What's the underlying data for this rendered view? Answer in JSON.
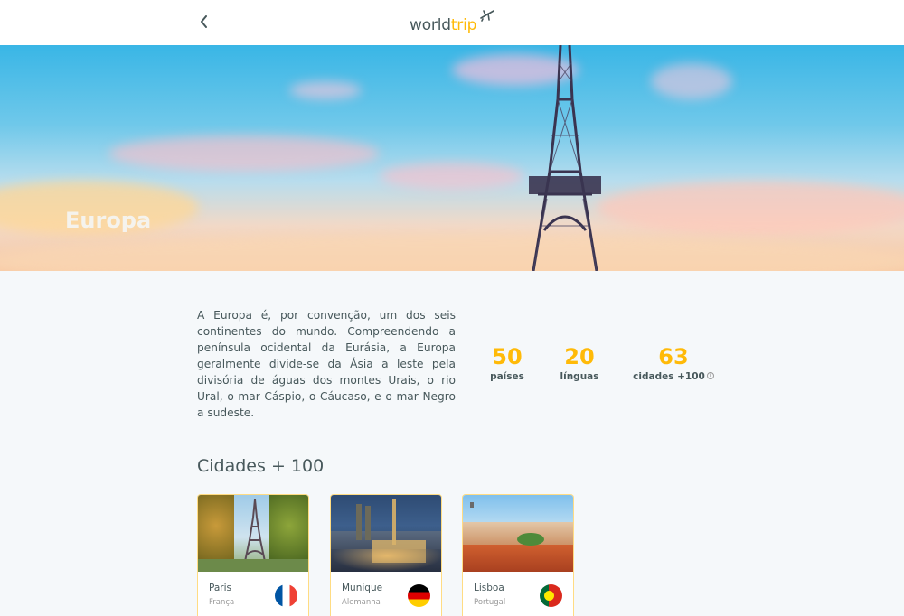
{
  "header": {
    "back_icon": "chevron-left-icon",
    "logo_main": "world",
    "logo_accent": "trip",
    "logo_icon": "airplane-icon",
    "accent_color": "#FFBA08"
  },
  "banner": {
    "title": "Europa"
  },
  "about": {
    "text": "A Europa é, por convenção, um dos seis continentes do mundo. Compreendendo a península ocidental da Eurásia, a Europa geralmente divide-se da Ásia a leste pela divisória de águas dos montes Urais, o rio Ural, o mar Cáspio, o Cáucaso, e o mar Negro a sudeste."
  },
  "stats": [
    {
      "value": "50",
      "label": "países"
    },
    {
      "value": "20",
      "label": "línguas"
    },
    {
      "value": "63",
      "label": "cidades +100",
      "icon": "info-icon"
    }
  ],
  "cities": {
    "heading": "Cidades + 100",
    "items": [
      {
        "city": "Paris",
        "country": "França",
        "flag": "france-flag-icon"
      },
      {
        "city": "Munique",
        "country": "Alemanha",
        "flag": "germany-flag-icon"
      },
      {
        "city": "Lisboa",
        "country": "Portugal",
        "flag": "portugal-flag-icon"
      }
    ]
  }
}
